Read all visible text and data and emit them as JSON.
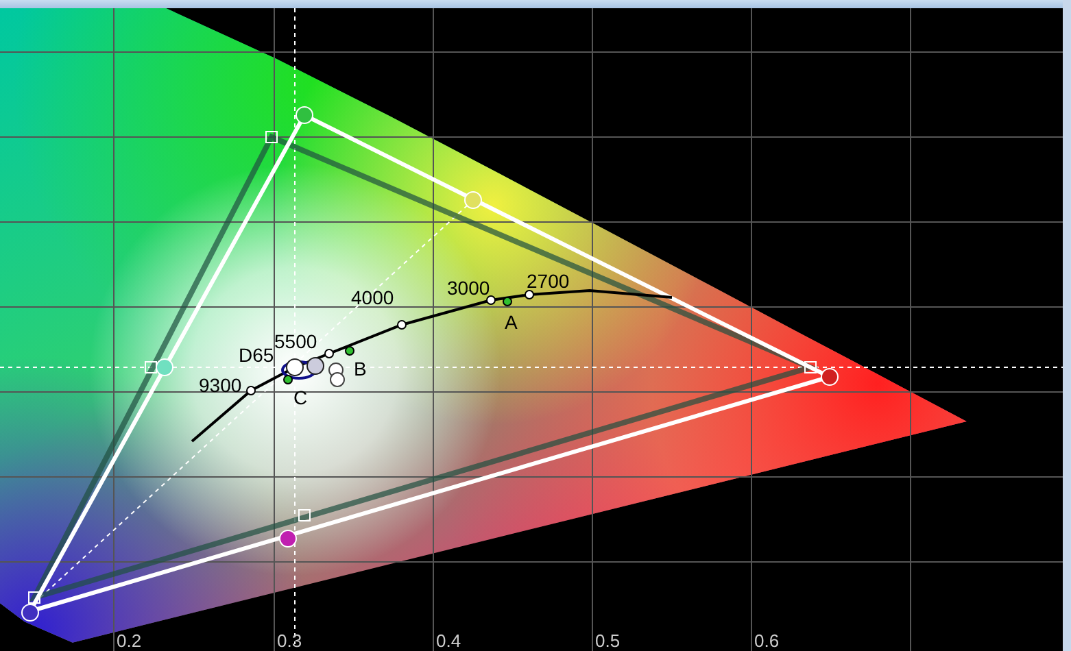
{
  "chart": {
    "x_tick_labels": [
      "0.2",
      "0.3",
      "0.4",
      "0.5",
      "0.6"
    ],
    "point_labels": [
      "3000",
      "2700",
      "4000",
      "5500",
      "D65",
      "9300",
      "A",
      "B",
      "C"
    ]
  }
}
